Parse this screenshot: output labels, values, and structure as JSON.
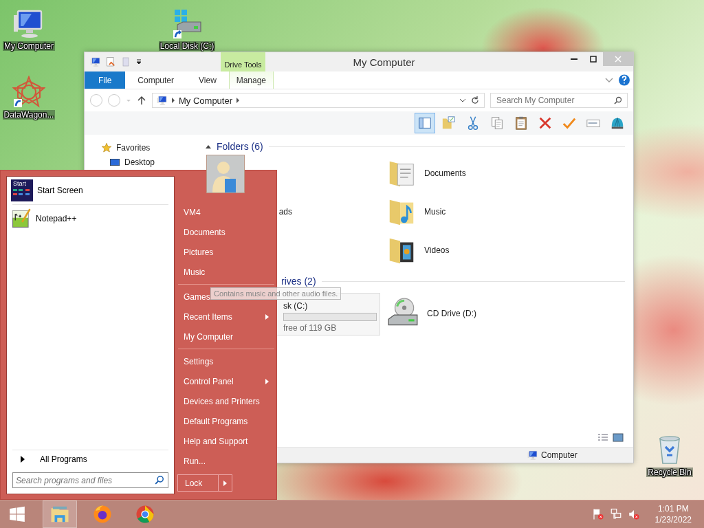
{
  "desktop_icons": [
    {
      "label": "My Computer",
      "kind": "computer"
    },
    {
      "label": "Local Disk (C:)",
      "kind": "disk"
    },
    {
      "label": "DataWagon...",
      "kind": "star"
    },
    {
      "label": "Recycle Bin",
      "kind": "bin"
    }
  ],
  "explorer": {
    "title": "My Computer",
    "contextual_group": "Drive Tools",
    "tabs": [
      {
        "label": "File",
        "kind": "file"
      },
      {
        "label": "Computer",
        "kind": "normal"
      },
      {
        "label": "View",
        "kind": "normal"
      },
      {
        "label": "Manage",
        "kind": "contextual"
      }
    ],
    "address": "My Computer",
    "search": {
      "placeholder": "Search My Computer"
    },
    "preview_pane": {
      "on": true
    },
    "toolbar": [
      {
        "kind": "folder"
      },
      {
        "kind": "cut"
      },
      {
        "kind": "copy"
      },
      {
        "kind": "paste"
      },
      {
        "kind": "delete"
      },
      {
        "kind": "check"
      },
      {
        "kind": "rename"
      },
      {
        "kind": "shell"
      }
    ],
    "nav": [
      {
        "label": "Favorites",
        "children": [
          {
            "label": "Desktop"
          }
        ]
      }
    ],
    "folders": {
      "title": "Folders (6)",
      "left_items": [
        {
          "label": "ads"
        }
      ],
      "items": [
        {
          "label": "Documents",
          "kind": "documents"
        },
        {
          "label": "Music",
          "kind": "music"
        },
        {
          "label": "Videos",
          "kind": "videos"
        }
      ]
    },
    "drives": {
      "title": "rives (2)",
      "left_tile": {
        "label": "sk (C:)",
        "detail": "free of 119 GB"
      },
      "items": [
        {
          "label": "CD Drive (D:)",
          "kind": "cd"
        }
      ]
    },
    "status_bar": {
      "location": "Computer"
    }
  },
  "start_menu": {
    "pinned": [
      {
        "label": "Start Screen",
        "kind": "start",
        "icon_text": "Start"
      },
      {
        "label": "Notepad++",
        "kind": "notepad"
      }
    ],
    "all_programs": "All Programs",
    "search": {
      "placeholder": "Search programs and files"
    },
    "right_items": [
      {
        "kind": "item",
        "label": "VM4",
        "has_submenu": false
      },
      {
        "kind": "item",
        "label": "Documents",
        "has_submenu": false
      },
      {
        "kind": "item",
        "label": "Pictures",
        "has_submenu": false
      },
      {
        "kind": "item",
        "label": "Music",
        "has_submenu": false
      },
      {
        "kind": "separator"
      },
      {
        "kind": "item",
        "label": "Games",
        "has_submenu": false
      },
      {
        "kind": "item",
        "label": "Recent Items",
        "has_submenu": true
      },
      {
        "kind": "item",
        "label": "My Computer",
        "has_submenu": false
      },
      {
        "kind": "separator"
      },
      {
        "kind": "item",
        "label": "Settings",
        "has_submenu": false
      },
      {
        "kind": "item",
        "label": "Control Panel",
        "has_submenu": true
      },
      {
        "kind": "item",
        "label": "Devices and Printers",
        "has_submenu": false
      },
      {
        "kind": "item",
        "label": "Default Programs",
        "has_submenu": false
      },
      {
        "kind": "item",
        "label": "Help and Support",
        "has_submenu": false
      },
      {
        "kind": "item",
        "label": "Run...",
        "has_submenu": false
      }
    ],
    "lock_button": "Lock"
  },
  "tooltip": "Contains music and other audio files.",
  "taskbar": {
    "apps": [
      {
        "kind": "explorer",
        "active": true
      },
      {
        "kind": "firefox",
        "active": false
      },
      {
        "kind": "chrome",
        "active": false
      }
    ],
    "tray": [
      {
        "kind": "flag"
      },
      {
        "kind": "network"
      },
      {
        "kind": "volume"
      }
    ],
    "time": "1:01 PM",
    "date": "1/23/2022"
  }
}
